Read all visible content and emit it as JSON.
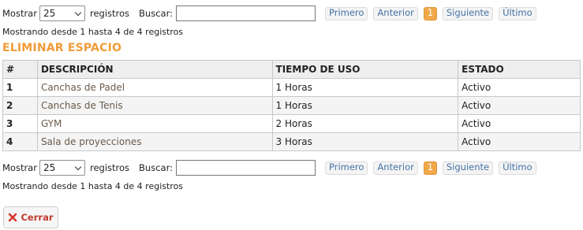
{
  "top_controls": {
    "show_label": "Mostrar",
    "page_size": "25",
    "records_label": "registros",
    "search_label": "Buscar:",
    "search_value": "",
    "pager": {
      "first": "Primero",
      "prev": "Anterior",
      "current": "1",
      "next": "Siguiente",
      "last": "Último"
    },
    "info": "Mostrando desde 1 hasta 4 de 4 registros"
  },
  "section_title": "ELIMINAR ESPACIO",
  "table": {
    "headers": [
      "#",
      "DESCRIPCIÓN",
      "TIEMPO DE USO",
      "ESTADO"
    ],
    "rows": [
      {
        "num": "1",
        "descripcion": "Canchas de Padel",
        "tiempo": "1 Horas",
        "estado": "Activo"
      },
      {
        "num": "2",
        "descripcion": "Canchas de Tenis",
        "tiempo": "1 Horas",
        "estado": "Activo"
      },
      {
        "num": "3",
        "descripcion": "GYM",
        "tiempo": "2 Horas",
        "estado": "Activo"
      },
      {
        "num": "4",
        "descripcion": "Sala de proyecciones",
        "tiempo": "3 Horas",
        "estado": "Activo"
      }
    ]
  },
  "bottom_controls": {
    "show_label": "Mostrar",
    "page_size": "25",
    "records_label": "registros",
    "search_label": "Buscar:",
    "search_value": "",
    "pager": {
      "first": "Primero",
      "prev": "Anterior",
      "current": "1",
      "next": "Siguiente",
      "last": "Último"
    },
    "info": "Mostrando desde 1 hasta 4 de 4 registros"
  },
  "close_button": {
    "label": "Cerrar",
    "icon": "close-x-icon"
  },
  "colors": {
    "accent": "#f29b38",
    "pager_text": "#4472a7",
    "close_icon": "#d63a2f"
  }
}
